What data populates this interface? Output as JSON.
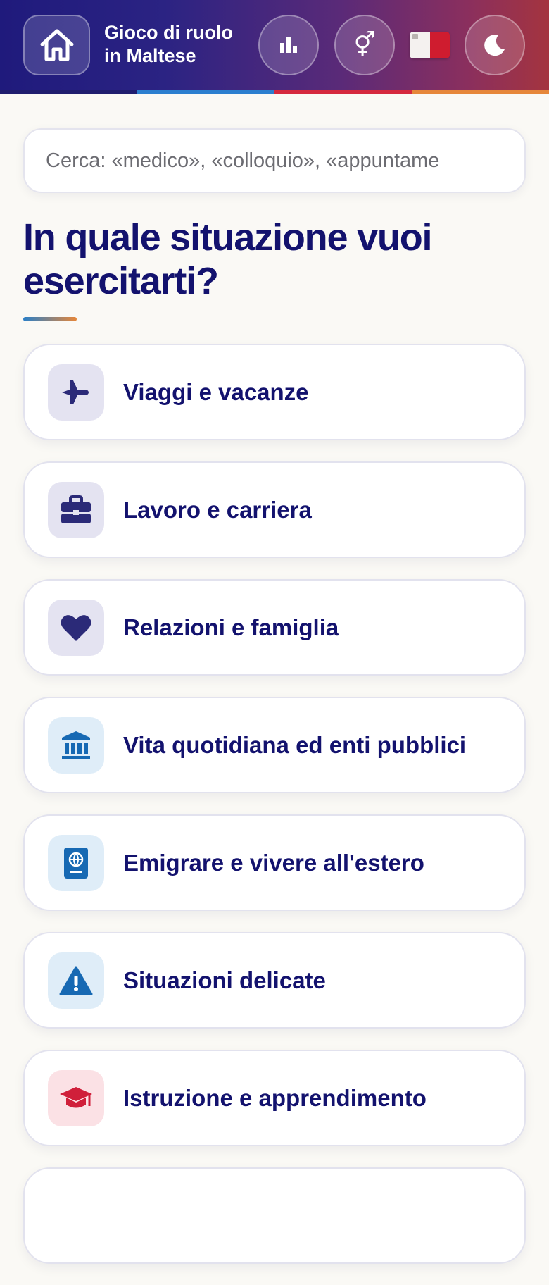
{
  "header": {
    "title_line1": "Gioco di ruolo",
    "title_line2": "in Maltese",
    "home_icon": "home-icon",
    "stats_icon": "bar-chart-icon",
    "gender_icon": "gender-icon",
    "gender_glyph": "⚥",
    "flag": "malta-flag",
    "theme_icon": "moon-icon",
    "stripe_colors": [
      "#1f1d6e",
      "#2b7fcf",
      "#d5293e",
      "#e6873a"
    ]
  },
  "search": {
    "placeholder": "Cerca: «medico», «colloquio», «appuntame"
  },
  "main": {
    "heading": "In quale situazione vuoi esercitarti?",
    "categories": [
      {
        "label": "Viaggi e vacanze",
        "icon": "airplane-icon",
        "tone": "navy"
      },
      {
        "label": "Lavoro e carriera",
        "icon": "briefcase-icon",
        "tone": "navy"
      },
      {
        "label": "Relazioni e famiglia",
        "icon": "heart-icon",
        "tone": "navy"
      },
      {
        "label": "Vita quotidiana ed enti pubblici",
        "icon": "bank-icon",
        "tone": "blue"
      },
      {
        "label": "Emigrare e vivere all'estero",
        "icon": "passport-icon",
        "tone": "blue"
      },
      {
        "label": "Situazioni delicate",
        "icon": "warning-icon",
        "tone": "blue"
      },
      {
        "label": "Istruzione e apprendimento",
        "icon": "graduation-cap-icon",
        "tone": "pink"
      }
    ]
  },
  "colors": {
    "navy": "#13126e",
    "icon_navy": "#2b2a78",
    "icon_blue": "#1769b3",
    "icon_red": "#d01f3a"
  }
}
